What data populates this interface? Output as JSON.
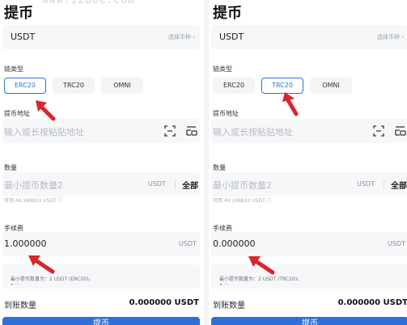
{
  "watermark": "www.12boe.com",
  "panels": [
    {
      "title": "提币",
      "coin": "USDT",
      "coin_hint": "选择币种 ›",
      "chain_label": "链类型",
      "chains": [
        "ERC20",
        "TRC20",
        "OMNI"
      ],
      "active_chain": "ERC20",
      "address_label": "提币地址",
      "address_placeholder": "输入或长按粘贴地址",
      "amount_label": "数量",
      "amount_placeholder": "最小提币数量2",
      "amount_unit": "USDT",
      "amount_all": "全部",
      "available": "可用 44.248833 USDT ⓘ",
      "fee_label": "手续费",
      "fee_value": "1.000000",
      "fee_unit": "USDT",
      "note_line1": "最小提币数量为：2 USDT (ERC20)。",
      "note_line2": "• ···",
      "receive_label": "到账数量",
      "receive_value": "0.000000 USDT",
      "submit_label": "提币"
    },
    {
      "title": "提币",
      "coin": "USDT",
      "coin_hint": "选择币种 ›",
      "chain_label": "链类型",
      "chains": [
        "ERC20",
        "TRC20",
        "OMNI"
      ],
      "active_chain": "TRC20",
      "address_label": "提币地址",
      "address_placeholder": "输入或长按粘贴地址",
      "amount_label": "数量",
      "amount_placeholder": "最小提币数量2",
      "amount_unit": "USDT",
      "amount_all": "全部",
      "available": "可用 44.248833 USDT ⓘ",
      "fee_label": "手续费",
      "fee_value": "0.000000",
      "fee_unit": "USDT",
      "note_line1": "最小提币数量为：2 USDT (TRC20)。",
      "note_line2": "• ···",
      "receive_label": "到账数量",
      "receive_value": "0.000000 USDT",
      "submit_label": "提币"
    }
  ],
  "colors": {
    "accent": "#2f6fd8",
    "arrow": "#d8262b",
    "field_bg": "#f6f7f9"
  },
  "icons": [
    "scan-icon",
    "address-book-icon",
    "info-icon",
    "chevron-right-icon",
    "red-arrow-icon"
  ]
}
